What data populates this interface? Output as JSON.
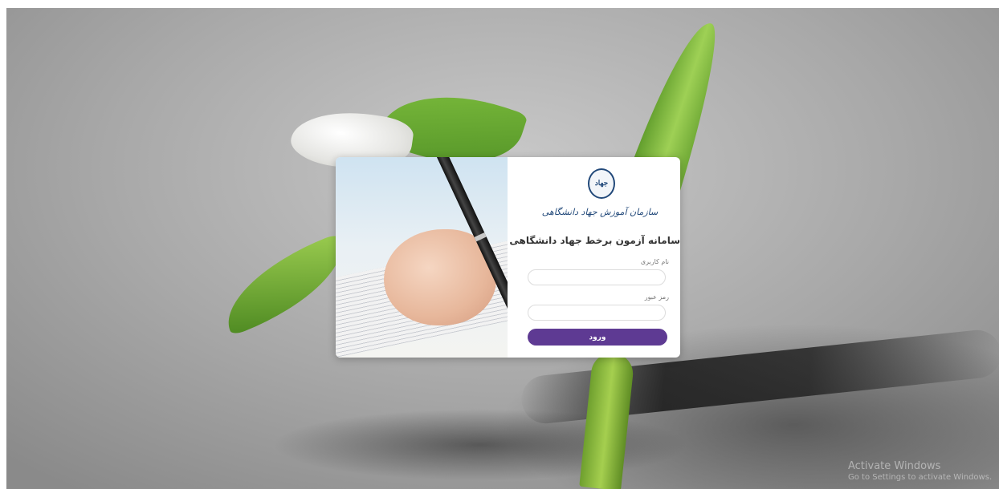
{
  "login": {
    "logo_text": "جهاد",
    "logo_subtext": "سازمان آموزش جهاد دانشگاهی",
    "title": "سامانه آزمون برخط جهاد دانشگاهی",
    "username_label": "نام کاربری",
    "username_value": "",
    "password_label": "رمز عبور",
    "password_value": "",
    "submit_label": "ورود"
  },
  "watermark": {
    "title": "Activate Windows",
    "subtitle": "Go to Settings to activate Windows."
  },
  "colors": {
    "button": "#5e3a93",
    "logo": "#22497a"
  }
}
